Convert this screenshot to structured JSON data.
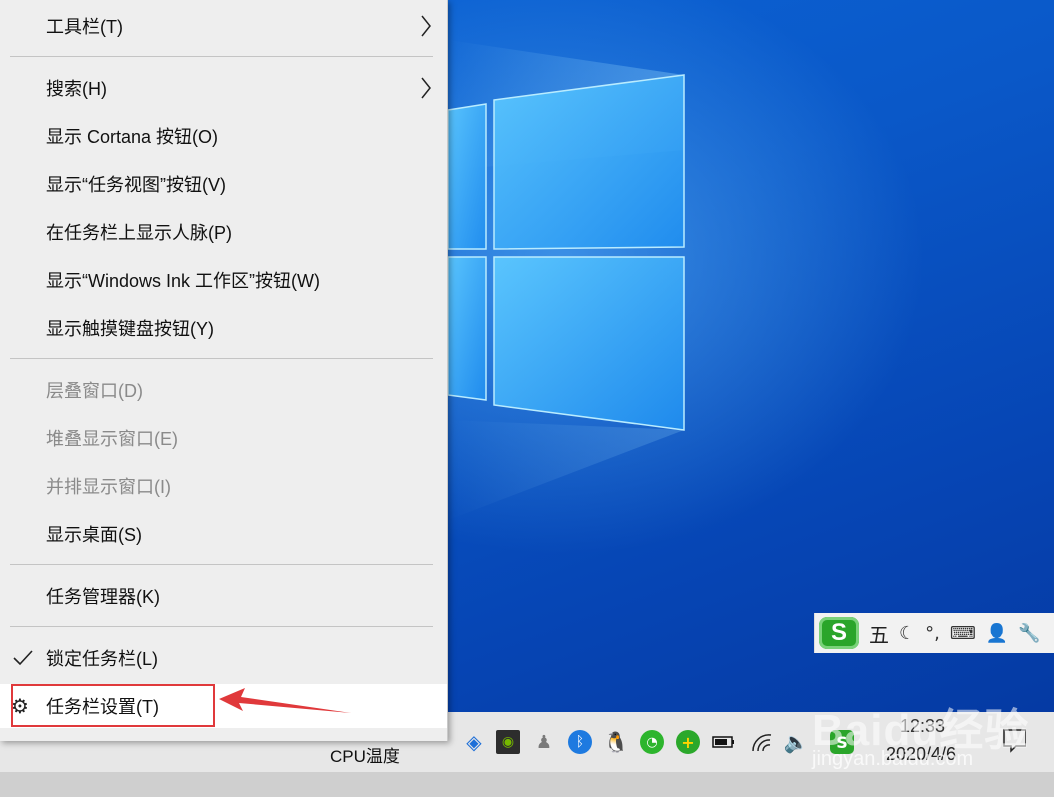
{
  "menu": {
    "items": [
      {
        "label": "工具栏(T)",
        "submenu": true
      },
      {
        "label": "搜索(H)",
        "submenu": true
      },
      {
        "label": "显示 Cortana 按钮(O)"
      },
      {
        "label": "显示“任务视图”按钮(V)"
      },
      {
        "label": "在任务栏上显示人脉(P)"
      },
      {
        "label": "显示“Windows Ink 工作区”按钮(W)"
      },
      {
        "label": "显示触摸键盘按钮(Y)"
      },
      {
        "label": "层叠窗口(D)",
        "disabled": true
      },
      {
        "label": "堆叠显示窗口(E)",
        "disabled": true
      },
      {
        "label": "并排显示窗口(I)",
        "disabled": true
      },
      {
        "label": "显示桌面(S)"
      },
      {
        "label": "任务管理器(K)"
      },
      {
        "label": "锁定任务栏(L)",
        "checked": true
      },
      {
        "label": "任务栏设置(T)",
        "icon": "gear-icon",
        "highlighted": true
      }
    ]
  },
  "ime": {
    "logo": "S",
    "mode": "五"
  },
  "taskbar": {
    "cpu_label": "CPU温度",
    "clock_time": "12:33",
    "clock_date": "2020/4/6"
  },
  "watermark": {
    "brand": "Baidu经验",
    "url": "jingyan.baidu.com"
  },
  "colors": {
    "accent": "#e0393b",
    "wallpaper": "#0a5fd0",
    "menu_bg": "#eeeeee"
  }
}
